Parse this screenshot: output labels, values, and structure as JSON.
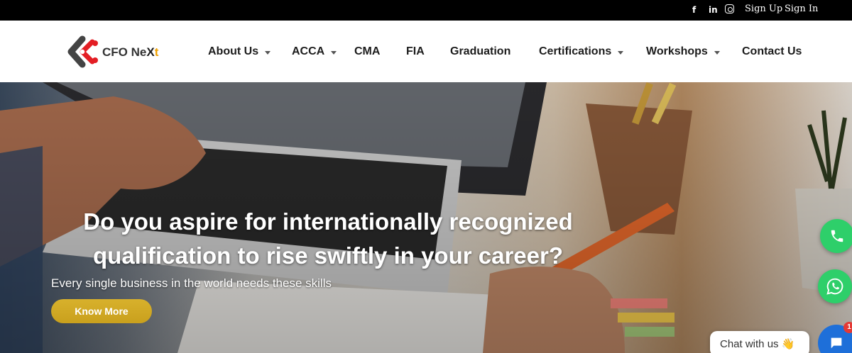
{
  "topbar": {
    "social": [
      "facebook-icon",
      "linkedin-icon",
      "instagram-icon"
    ],
    "fb_glyph": "f",
    "li_glyph": "in",
    "sign_up": "Sign Up",
    "sign_in": "Sign In"
  },
  "brand": {
    "name_a": "CFO Ne",
    "name_b": "X",
    "name_c": "t",
    "accent": "#e31e24"
  },
  "nav": {
    "items": [
      {
        "label": "About Us",
        "dropdown": true
      },
      {
        "label": "ACCA",
        "dropdown": true
      },
      {
        "label": "CMA",
        "dropdown": false
      },
      {
        "label": "FIA",
        "dropdown": false
      },
      {
        "label": "Graduation",
        "dropdown": false
      },
      {
        "label": "Certifications",
        "dropdown": true
      },
      {
        "label": "Workshops",
        "dropdown": true
      },
      {
        "label": "Contact Us",
        "dropdown": false
      }
    ]
  },
  "hero": {
    "headline": "Do you aspire for internationally recognized qualification to rise swiftly in your career?",
    "subtext": "Every single business in the world needs these skills",
    "cta_label": "Know More",
    "cta_color": "#d4aa24"
  },
  "widgets": {
    "phone_icon": "phone-icon",
    "whatsapp_icon": "whatsapp-icon",
    "chat_label": "Chat with us",
    "chat_emoji": "👋",
    "badge_count": "1"
  }
}
